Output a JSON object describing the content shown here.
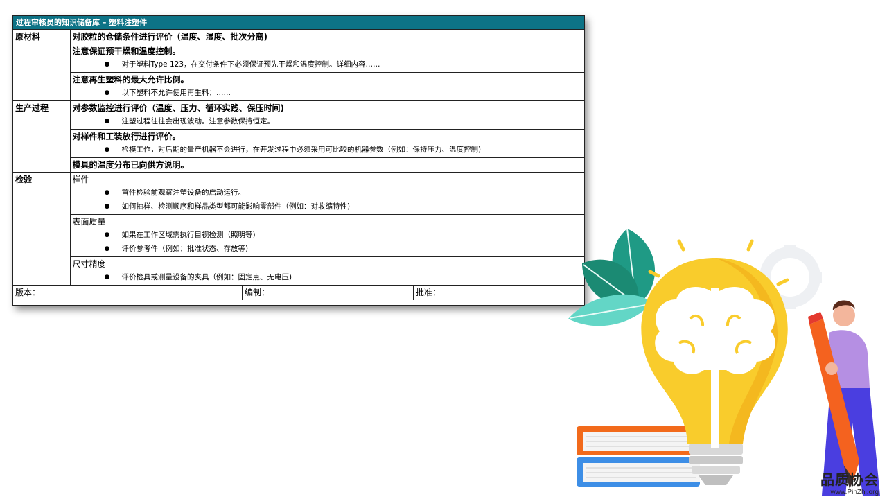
{
  "document": {
    "title": "过程审核员的知识储备库 – 塑料注塑件",
    "sections": [
      {
        "category": "原材料",
        "rows": [
          {
            "heading": "对胶粒的仓储条件进行评价（温度、湿度、批次分离)",
            "bold": true,
            "bullets": []
          },
          {
            "heading": "注意保证预干燥和温度控制。",
            "bold": true,
            "bullets": [
              "对于塑料Type 123，在交付条件下必须保证预先干燥和温度控制。详细内容……"
            ]
          },
          {
            "heading": "注意再生塑料的最大允许比例。",
            "bold": true,
            "bullets": [
              "以下塑料不允许使用再生料：……"
            ]
          }
        ]
      },
      {
        "category": "生产过程",
        "rows": [
          {
            "heading": "对参数监控进行评价（温度、压力、循环实践、保压时间)",
            "bold": true,
            "bullets": [
              "注塑过程往往会出现波动。注意参数保持恒定。"
            ]
          },
          {
            "heading": "对样件和工装放行进行评价。",
            "bold": true,
            "bullets": [
              "检模工作，对后期的量产机器不会进行，在开发过程中必须采用可比较的机器参数（例如：保持压力、温度控制)"
            ]
          },
          {
            "heading": "模具的温度分布已向供方说明。",
            "bold": true,
            "bullets": []
          }
        ]
      },
      {
        "category": "检验",
        "rows": [
          {
            "heading": "样件",
            "bold": false,
            "bullets": [
              "首件检验前观察注塑设备的启动运行。",
              "如何抽样、检测顺序和样品类型都可能影响零部件（例如：对收缩特性)"
            ]
          },
          {
            "heading": "表面质量",
            "bold": false,
            "bullets": [
              "如果在工作区域需执行目视检测（照明等)",
              "评价参考件（例如：批准状态、存放等)"
            ]
          },
          {
            "heading": "尺寸精度",
            "bold": false,
            "bullets": [
              "评价检具或测量设备的夹具（例如：固定点、无电压)"
            ]
          }
        ]
      }
    ],
    "footer": {
      "version_label": "版本：",
      "editor_label": "编制：",
      "approver_label": "批准："
    }
  },
  "logo": {
    "name": "品质协会",
    "url": "www.PinZhi.org"
  },
  "colors": {
    "title_bar": "#0d7386",
    "bulb": "#f9cc2c",
    "leaf_dark": "#1f9a85",
    "leaf_light": "#63d6c6",
    "pencil": "#f4621f",
    "person_shirt": "#b58fe3",
    "person_pants": "#4a3ee0"
  }
}
